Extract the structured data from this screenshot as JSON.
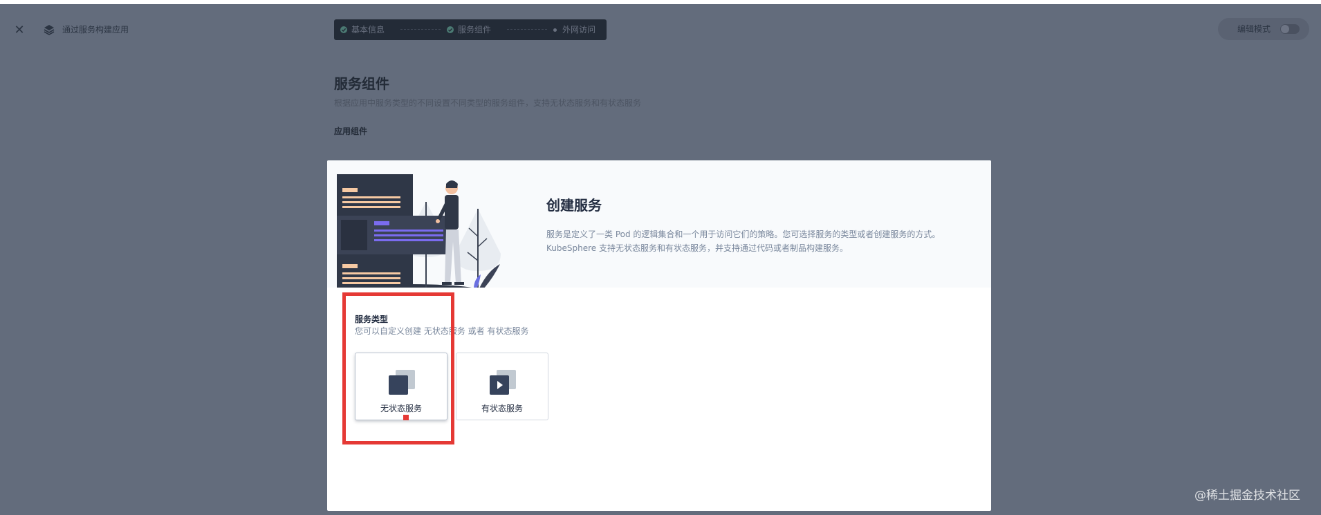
{
  "header": {
    "title": "通过服务构建应用",
    "close_label": "✕",
    "edit_mode_label": "编辑模式"
  },
  "steps": [
    {
      "label": "基本信息",
      "status": "done"
    },
    {
      "label": "服务组件",
      "status": "done"
    },
    {
      "label": "外网访问",
      "status": "current"
    }
  ],
  "background_page": {
    "title": "服务组件",
    "description": "根据应用中服务类型的不同设置不同类型的服务组件，支持无状态服务和有状态服务",
    "subsection": "应用组件"
  },
  "modal": {
    "title": "创建服务",
    "description_line1": "服务是定义了一类 Pod 的逻辑集合和一个用于访问它们的策略。您可选择服务的类型或者创建服务的方式。",
    "description_line2": "KubeSphere 支持无状态服务和有状态服务，并支持通过代码或者制品构建服务。",
    "service_type": {
      "title": "服务类型",
      "description": "您可以自定义创建 无状态服务 或者 有状态服务",
      "options": [
        {
          "label": "无状态服务",
          "icon": "stateless-service-icon"
        },
        {
          "label": "有状态服务",
          "icon": "stateful-service-icon"
        }
      ]
    }
  },
  "watermark": "@稀土掘金技术社区",
  "colors": {
    "overlay": "#636c7c",
    "step_bar": "#232b37",
    "accent_highlight": "#e53935",
    "check": "#4b7a73"
  }
}
